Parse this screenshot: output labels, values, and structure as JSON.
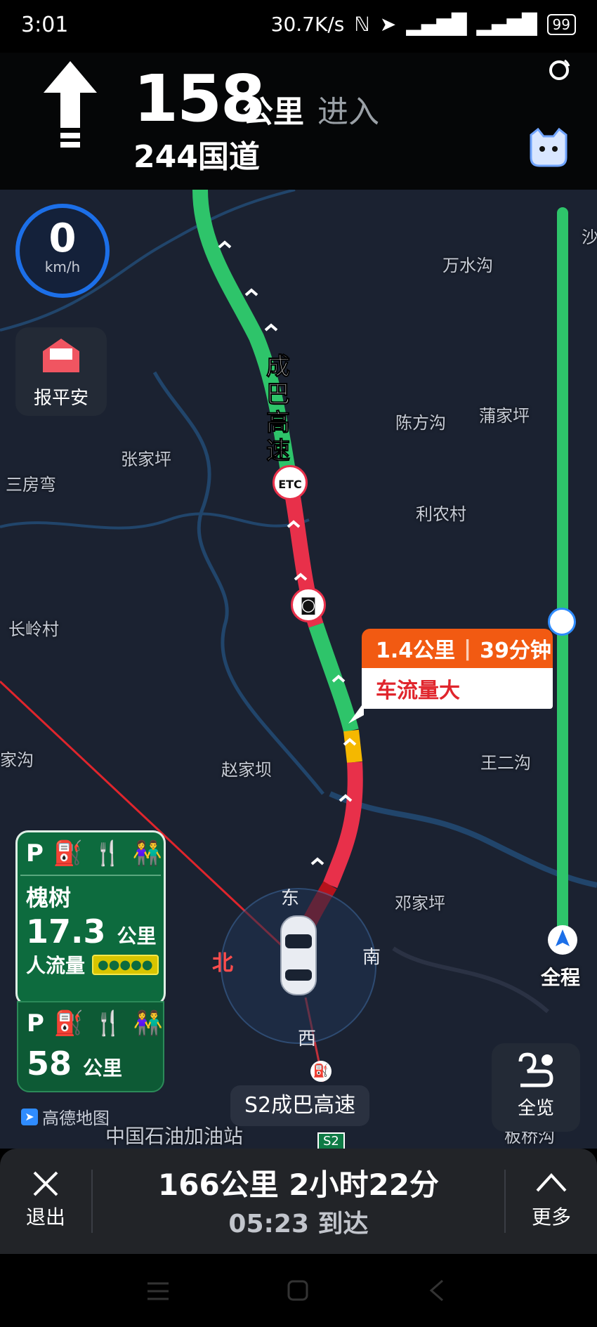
{
  "status_bar": {
    "time": "3:01",
    "net_speed": "30.7K/s",
    "battery": "99"
  },
  "nav_header": {
    "distance": "158",
    "distance_unit": "公里",
    "action": "进入",
    "road": "244国道"
  },
  "speed": {
    "value": "0",
    "unit": "km/h"
  },
  "safe_button": {
    "label": "报平安"
  },
  "map": {
    "places": [
      "万水沟",
      "陈方沟",
      "蒲家坪",
      "张家坪",
      "三房弯",
      "利农村",
      "长岭村",
      "家沟",
      "赵家坝",
      "王二沟",
      "邓家坪",
      "沙"
    ],
    "route_name": "成巴高速",
    "etc_label": "ETC",
    "directions": {
      "east": "东",
      "south": "南",
      "north": "北",
      "west": "西"
    },
    "poi_label": "中国石油加油站",
    "poi_label2": "板桥沟",
    "shield": "S2"
  },
  "traffic_popup": {
    "distance": "1.4公里",
    "duration": "39分钟",
    "status": "车流量大"
  },
  "service_area_1": {
    "name": "槐树",
    "distance": "17.3",
    "unit": "公里",
    "crowd_label": "人流量"
  },
  "service_area_2": {
    "distance": "58",
    "unit": "公里"
  },
  "brand": "高德地图",
  "current_road": "S2成巴高速",
  "progress": {
    "label": "全程"
  },
  "overview": {
    "label": "全览"
  },
  "bottom_bar": {
    "exit_label": "退出",
    "summary": "166公里 2小时22分",
    "eta": "05:23 到达",
    "more_label": "更多"
  },
  "colors": {
    "congested": "#e8304a",
    "heavy": "#b5121b",
    "slow": "#f5b800",
    "clear": "#2ec46a",
    "popup": "#f25a12"
  }
}
